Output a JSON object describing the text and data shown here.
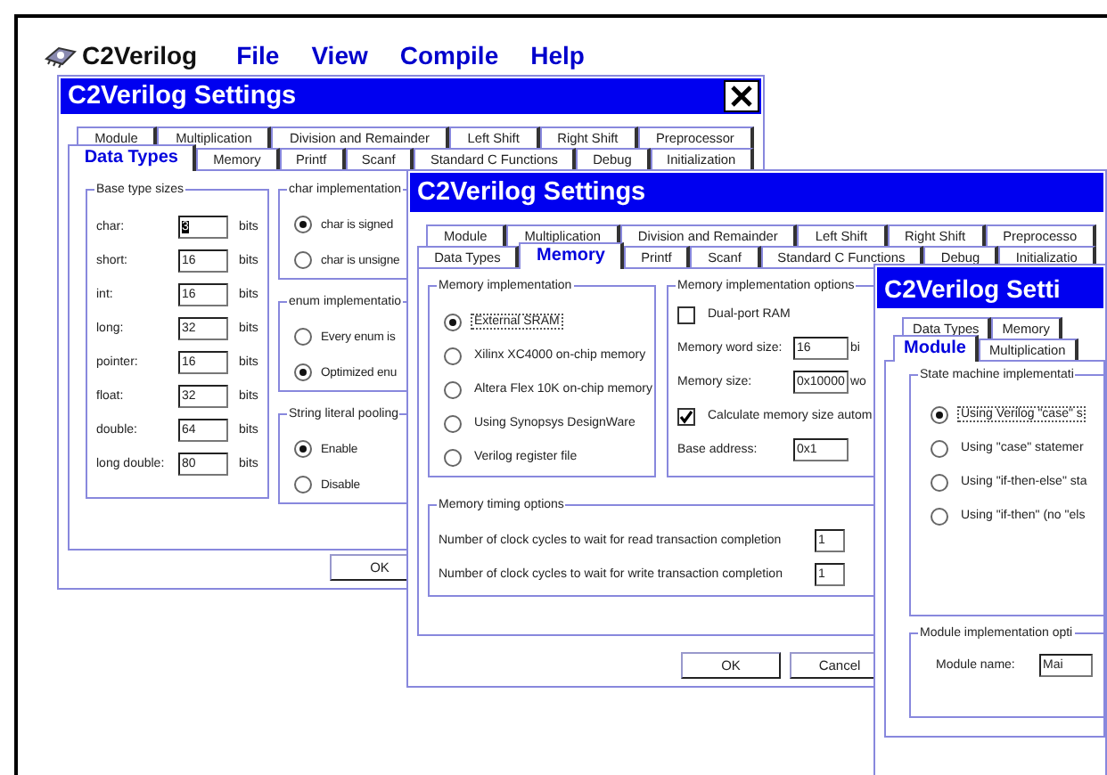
{
  "app": {
    "title": "C2Verilog",
    "menu": [
      "File",
      "View",
      "Compile",
      "Help"
    ]
  },
  "data_types_window": {
    "title": "C2Verilog Settings",
    "tab_rows": [
      [
        {
          "label": "Module",
          "selected": false
        },
        {
          "label": "Multiplication",
          "selected": false
        },
        {
          "label": "Division and Remainder",
          "selected": false
        },
        {
          "label": "Left Shift",
          "selected": false
        },
        {
          "label": "Right Shift",
          "selected": false
        },
        {
          "label": "Preprocessor",
          "selected": false
        }
      ],
      [
        {
          "label": "Data Types",
          "selected": true
        },
        {
          "label": "Memory",
          "selected": false
        },
        {
          "label": "Printf",
          "selected": false
        },
        {
          "label": "Scanf",
          "selected": false
        },
        {
          "label": "Standard C Functions",
          "selected": false
        },
        {
          "label": "Debug",
          "selected": false
        },
        {
          "label": "Initialization",
          "selected": false
        }
      ]
    ],
    "base_type_sizes": {
      "title": "Base type sizes",
      "rows": [
        {
          "label": "char:",
          "value": "3",
          "highlighted": true,
          "unit": "bits"
        },
        {
          "label": "short:",
          "value": "16",
          "highlighted": false,
          "unit": "bits"
        },
        {
          "label": "int:",
          "value": "16",
          "highlighted": false,
          "unit": "bits"
        },
        {
          "label": "long:",
          "value": "32",
          "highlighted": false,
          "unit": "bits"
        },
        {
          "label": "pointer:",
          "value": "16",
          "highlighted": false,
          "unit": "bits"
        },
        {
          "label": "float:",
          "value": "32",
          "highlighted": false,
          "unit": "bits"
        },
        {
          "label": "double:",
          "value": "64",
          "highlighted": false,
          "unit": "bits"
        },
        {
          "label": "long double:",
          "value": "80",
          "highlighted": false,
          "unit": "bits"
        }
      ]
    },
    "groups": [
      {
        "title": "char implementation",
        "options": [
          {
            "label": "char is signed",
            "selected": true,
            "focused": false
          },
          {
            "label": "char is unsigne",
            "selected": false,
            "focused": false
          }
        ]
      },
      {
        "title": "enum implementatio",
        "options": [
          {
            "label": "Every enum is",
            "selected": false,
            "focused": false
          },
          {
            "label": "Optimized enu",
            "selected": true,
            "focused": false
          }
        ]
      },
      {
        "title": "String literal pooling",
        "options": [
          {
            "label": "Enable",
            "selected": true,
            "focused": false
          },
          {
            "label": "Disable",
            "selected": false,
            "focused": false
          }
        ]
      }
    ],
    "buttons": [
      "OK"
    ]
  },
  "memory_window": {
    "title": "C2Verilog Settings",
    "tab_rows": [
      [
        {
          "label": "Module",
          "selected": false
        },
        {
          "label": "Multiplication",
          "selected": false
        },
        {
          "label": "Division and Remainder",
          "selected": false
        },
        {
          "label": "Left Shift",
          "selected": false
        },
        {
          "label": "Right Shift",
          "selected": false
        },
        {
          "label": "Preprocesso",
          "selected": false
        }
      ],
      [
        {
          "label": "Data Types",
          "selected": false
        },
        {
          "label": "Memory",
          "selected": true
        },
        {
          "label": "Printf",
          "selected": false
        },
        {
          "label": "Scanf",
          "selected": false
        },
        {
          "label": "Standard C Functions",
          "selected": false
        },
        {
          "label": "Debug",
          "selected": false
        },
        {
          "label": "Initializatio",
          "selected": false
        }
      ]
    ],
    "implementation": {
      "title": "Memory implementation",
      "options": [
        {
          "label": "External SRAM",
          "selected": true,
          "focused": true
        },
        {
          "label": "Xilinx XC4000 on-chip memory",
          "selected": false,
          "focused": false
        },
        {
          "label": "Altera Flex 10K on-chip memory",
          "selected": false,
          "focused": false
        },
        {
          "label": "Using Synopsys DesignWare",
          "selected": false,
          "focused": false
        },
        {
          "label": "Verilog register file",
          "selected": false,
          "focused": false
        }
      ]
    },
    "implementation_options": {
      "title": "Memory implementation options",
      "items": [
        {
          "kind": "checkbox",
          "label": "Dual-port RAM",
          "checked": false
        },
        {
          "kind": "field",
          "label": "Memory word size:",
          "value": "16",
          "unit": "bi"
        },
        {
          "kind": "field",
          "label": "Memory size:",
          "value": "0x10000",
          "unit": "wo"
        },
        {
          "kind": "checkbox",
          "label": "Calculate memory size autom",
          "checked": true
        },
        {
          "kind": "field",
          "label": "Base address:",
          "value": "0x1"
        }
      ]
    },
    "timing": {
      "title": "Memory timing options",
      "rows": [
        {
          "label": "Number of clock cycles to wait for read transaction completion",
          "value": "1"
        },
        {
          "label": "Number of clock cycles to wait for write transaction completion",
          "value": "1"
        }
      ]
    },
    "buttons": [
      "OK",
      "Cancel"
    ]
  },
  "module_window": {
    "title": "C2Verilog Setti",
    "tab_rows": [
      [
        {
          "label": "Data Types",
          "selected": false
        },
        {
          "label": "Memory",
          "selected": false
        }
      ],
      [
        {
          "label": "Module",
          "selected": true
        },
        {
          "label": "Multiplication",
          "selected": false
        }
      ]
    ],
    "state_machine": {
      "title": "State machine implementati",
      "options": [
        {
          "label": "Using Verilog \"case\" s",
          "selected": true,
          "focused": true
        },
        {
          "label": "Using \"case\" statemer",
          "selected": false,
          "focused": false
        },
        {
          "label": "Using \"if-then-else\" sta",
          "selected": false,
          "focused": false
        },
        {
          "label": "Using \"if-then\" (no \"els",
          "selected": false,
          "focused": false
        }
      ]
    },
    "module_options": {
      "title": "Module implementation opti",
      "field_label": "Module name:",
      "field_value": "Mai"
    }
  }
}
